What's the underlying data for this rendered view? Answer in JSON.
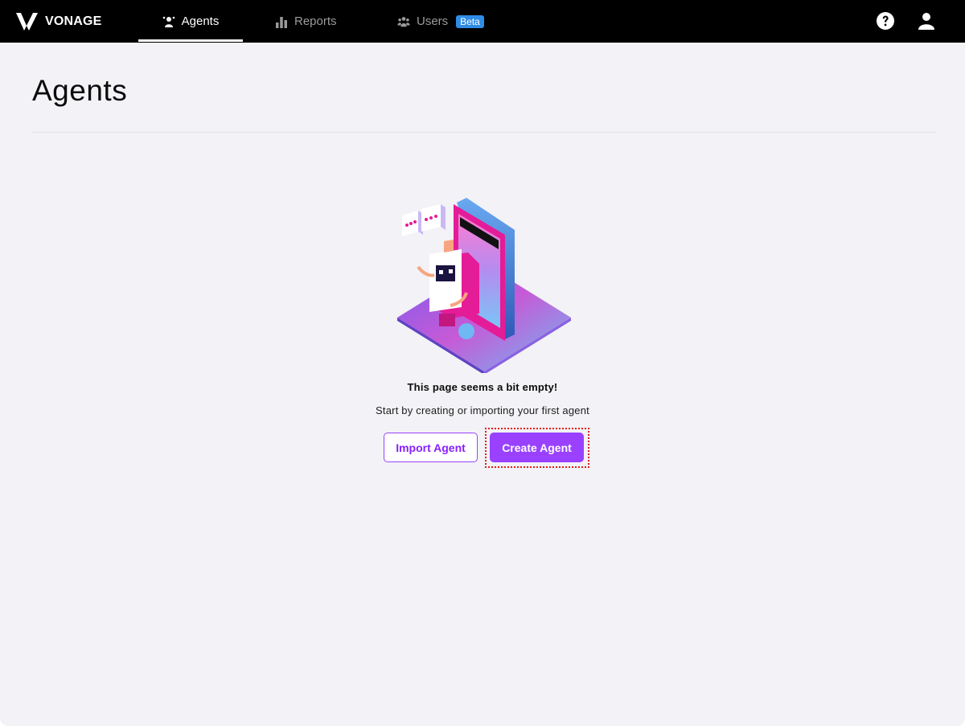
{
  "brand": {
    "name": "VONAGE",
    "logo_icon": "vonage-v-icon"
  },
  "nav": {
    "tabs": [
      {
        "label": "Agents",
        "icon": "agents-icon",
        "active": true
      },
      {
        "label": "Reports",
        "icon": "bar-chart-icon",
        "active": false
      },
      {
        "label": "Users",
        "icon": "users-icon",
        "active": false,
        "badge": "Beta"
      }
    ],
    "actions": [
      {
        "icon": "help-icon"
      },
      {
        "icon": "user-account-icon"
      }
    ]
  },
  "page": {
    "title": "Agents",
    "empty_state": {
      "illustration": "robot-phone-illustration",
      "title": "This page seems a bit empty!",
      "subtitle": "Start by creating or importing your first agent"
    },
    "buttons": {
      "import_label": "Import Agent",
      "create_label": "Create Agent"
    }
  },
  "colors": {
    "nav_bg": "#000000",
    "page_bg": "#f3f2f6",
    "accent": "#9941ff",
    "beta_badge": "#2f8ce6",
    "highlight": "#e31b1b"
  }
}
